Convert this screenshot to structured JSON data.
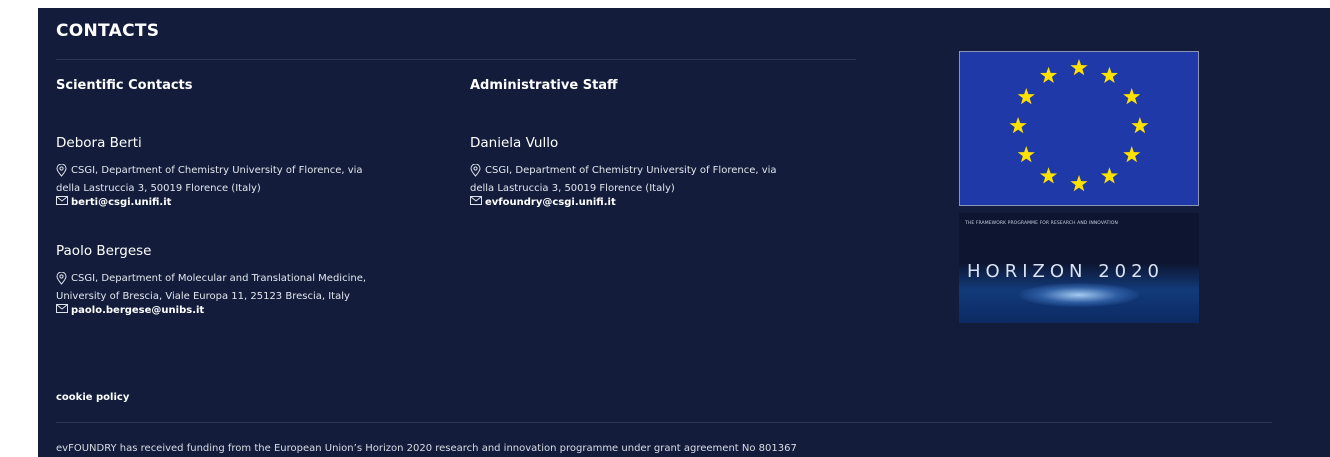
{
  "section": {
    "title": "CONTACTS"
  },
  "scientific": {
    "heading": "Scientific Contacts",
    "people": [
      {
        "name": "Debora Berti",
        "address_line1": "CSGI, Department of Chemistry University of Florence, via",
        "address_line2": "della Lastruccia 3, 50019 Florence (Italy)",
        "email": "berti@csgi.unifi.it"
      },
      {
        "name": "Paolo Bergese",
        "address_line1": "CSGI, Department of Molecular and Translational Medicine,",
        "address_line2": "University of Brescia, Viale Europa 11, 25123 Brescia, Italy",
        "email": "paolo.bergese@unibs.it"
      }
    ]
  },
  "administrative": {
    "heading": "Administrative Staff",
    "people": [
      {
        "name": "Daniela Vullo",
        "address_line1": "CSGI, Department of Chemistry University of Florence, via",
        "address_line2": "della Lastruccia 3, 50019 Florence (Italy)",
        "email": "evfoundry@csgi.unifi.it"
      }
    ]
  },
  "footer": {
    "cookie_link": "cookie policy",
    "funding_text": "evFOUNDRY has received funding from the European Union’s Horizon 2020 research and innovation programme under grant agreement No 801367"
  },
  "logos": {
    "horizon_caption": "THE FRAMEWORK PROGRAMME FOR RESEARCH AND INNOVATION",
    "horizon_text": "HORIZON 2020"
  },
  "colors": {
    "background": "#131d3b",
    "eu_blue": "#1f3aa8",
    "eu_star": "#ffe100"
  },
  "icons": {
    "address": "location-pin-icon",
    "email": "envelope-icon"
  }
}
